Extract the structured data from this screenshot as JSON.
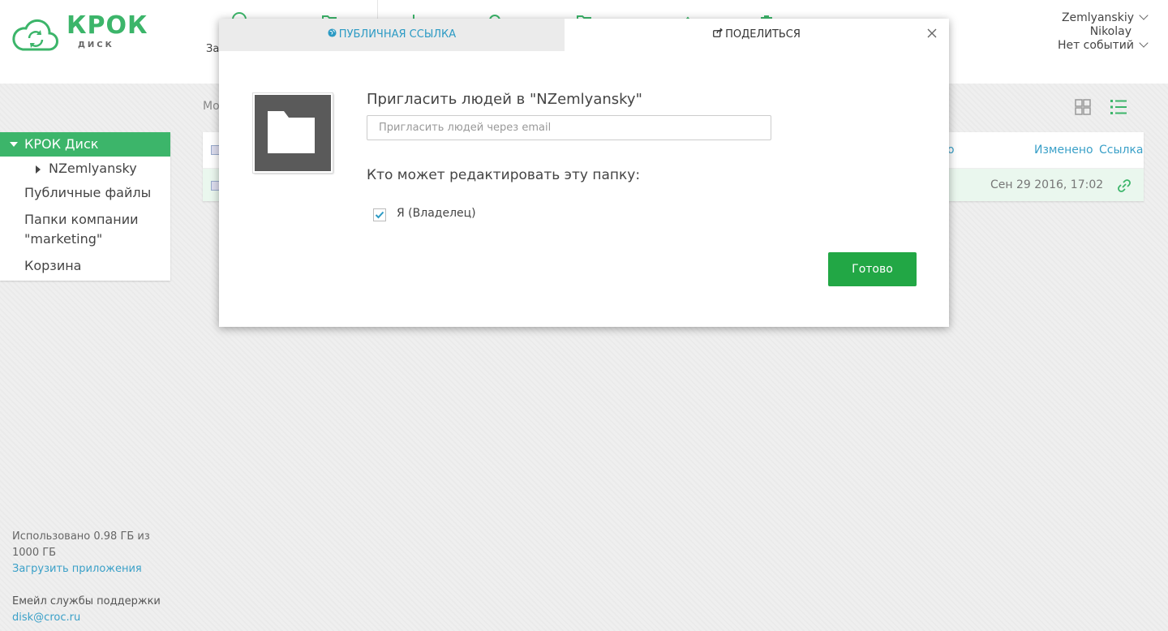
{
  "app": {
    "logo_word": "КРОК",
    "logo_sub": "ДИСК",
    "accent": "#3cb56a"
  },
  "toolbar": {
    "partial_label": "За"
  },
  "user": {
    "username": "Zemlyanskiy",
    "name": "Nikolay",
    "events": "Нет событий"
  },
  "sidebar": {
    "root": "КРОК Диск",
    "sub": "NZemlyansky",
    "public_files": "Публичные файлы",
    "company_folders": "Папки компании \"marketing\"",
    "trash": "Корзина"
  },
  "main": {
    "breadcrumb": "Мо",
    "header": {
      "modified": "Изменено",
      "link": "Ссылка",
      "partial": "о"
    },
    "row": {
      "date": "Сен 29 2016, 17:02"
    }
  },
  "footer": {
    "usage": "Использовано 0.98 ГБ из 1000 ГБ",
    "apps_link": "Загрузить приложения",
    "support_label": "Емейл службы поддержки",
    "support_email": "disk@croc.ru"
  },
  "modal": {
    "tab_public": "ПУБЛИЧНАЯ ССЫЛКА",
    "tab_share": "ПОДЕЛИТЬСЯ",
    "invite_title": "Пригласить людей в \"NZemlyansky\"",
    "email_placeholder": "Пригласить людей через email",
    "who_edit": "Кто может редактировать эту папку:",
    "owner": "Я (Владелец)",
    "done": "Готово"
  }
}
